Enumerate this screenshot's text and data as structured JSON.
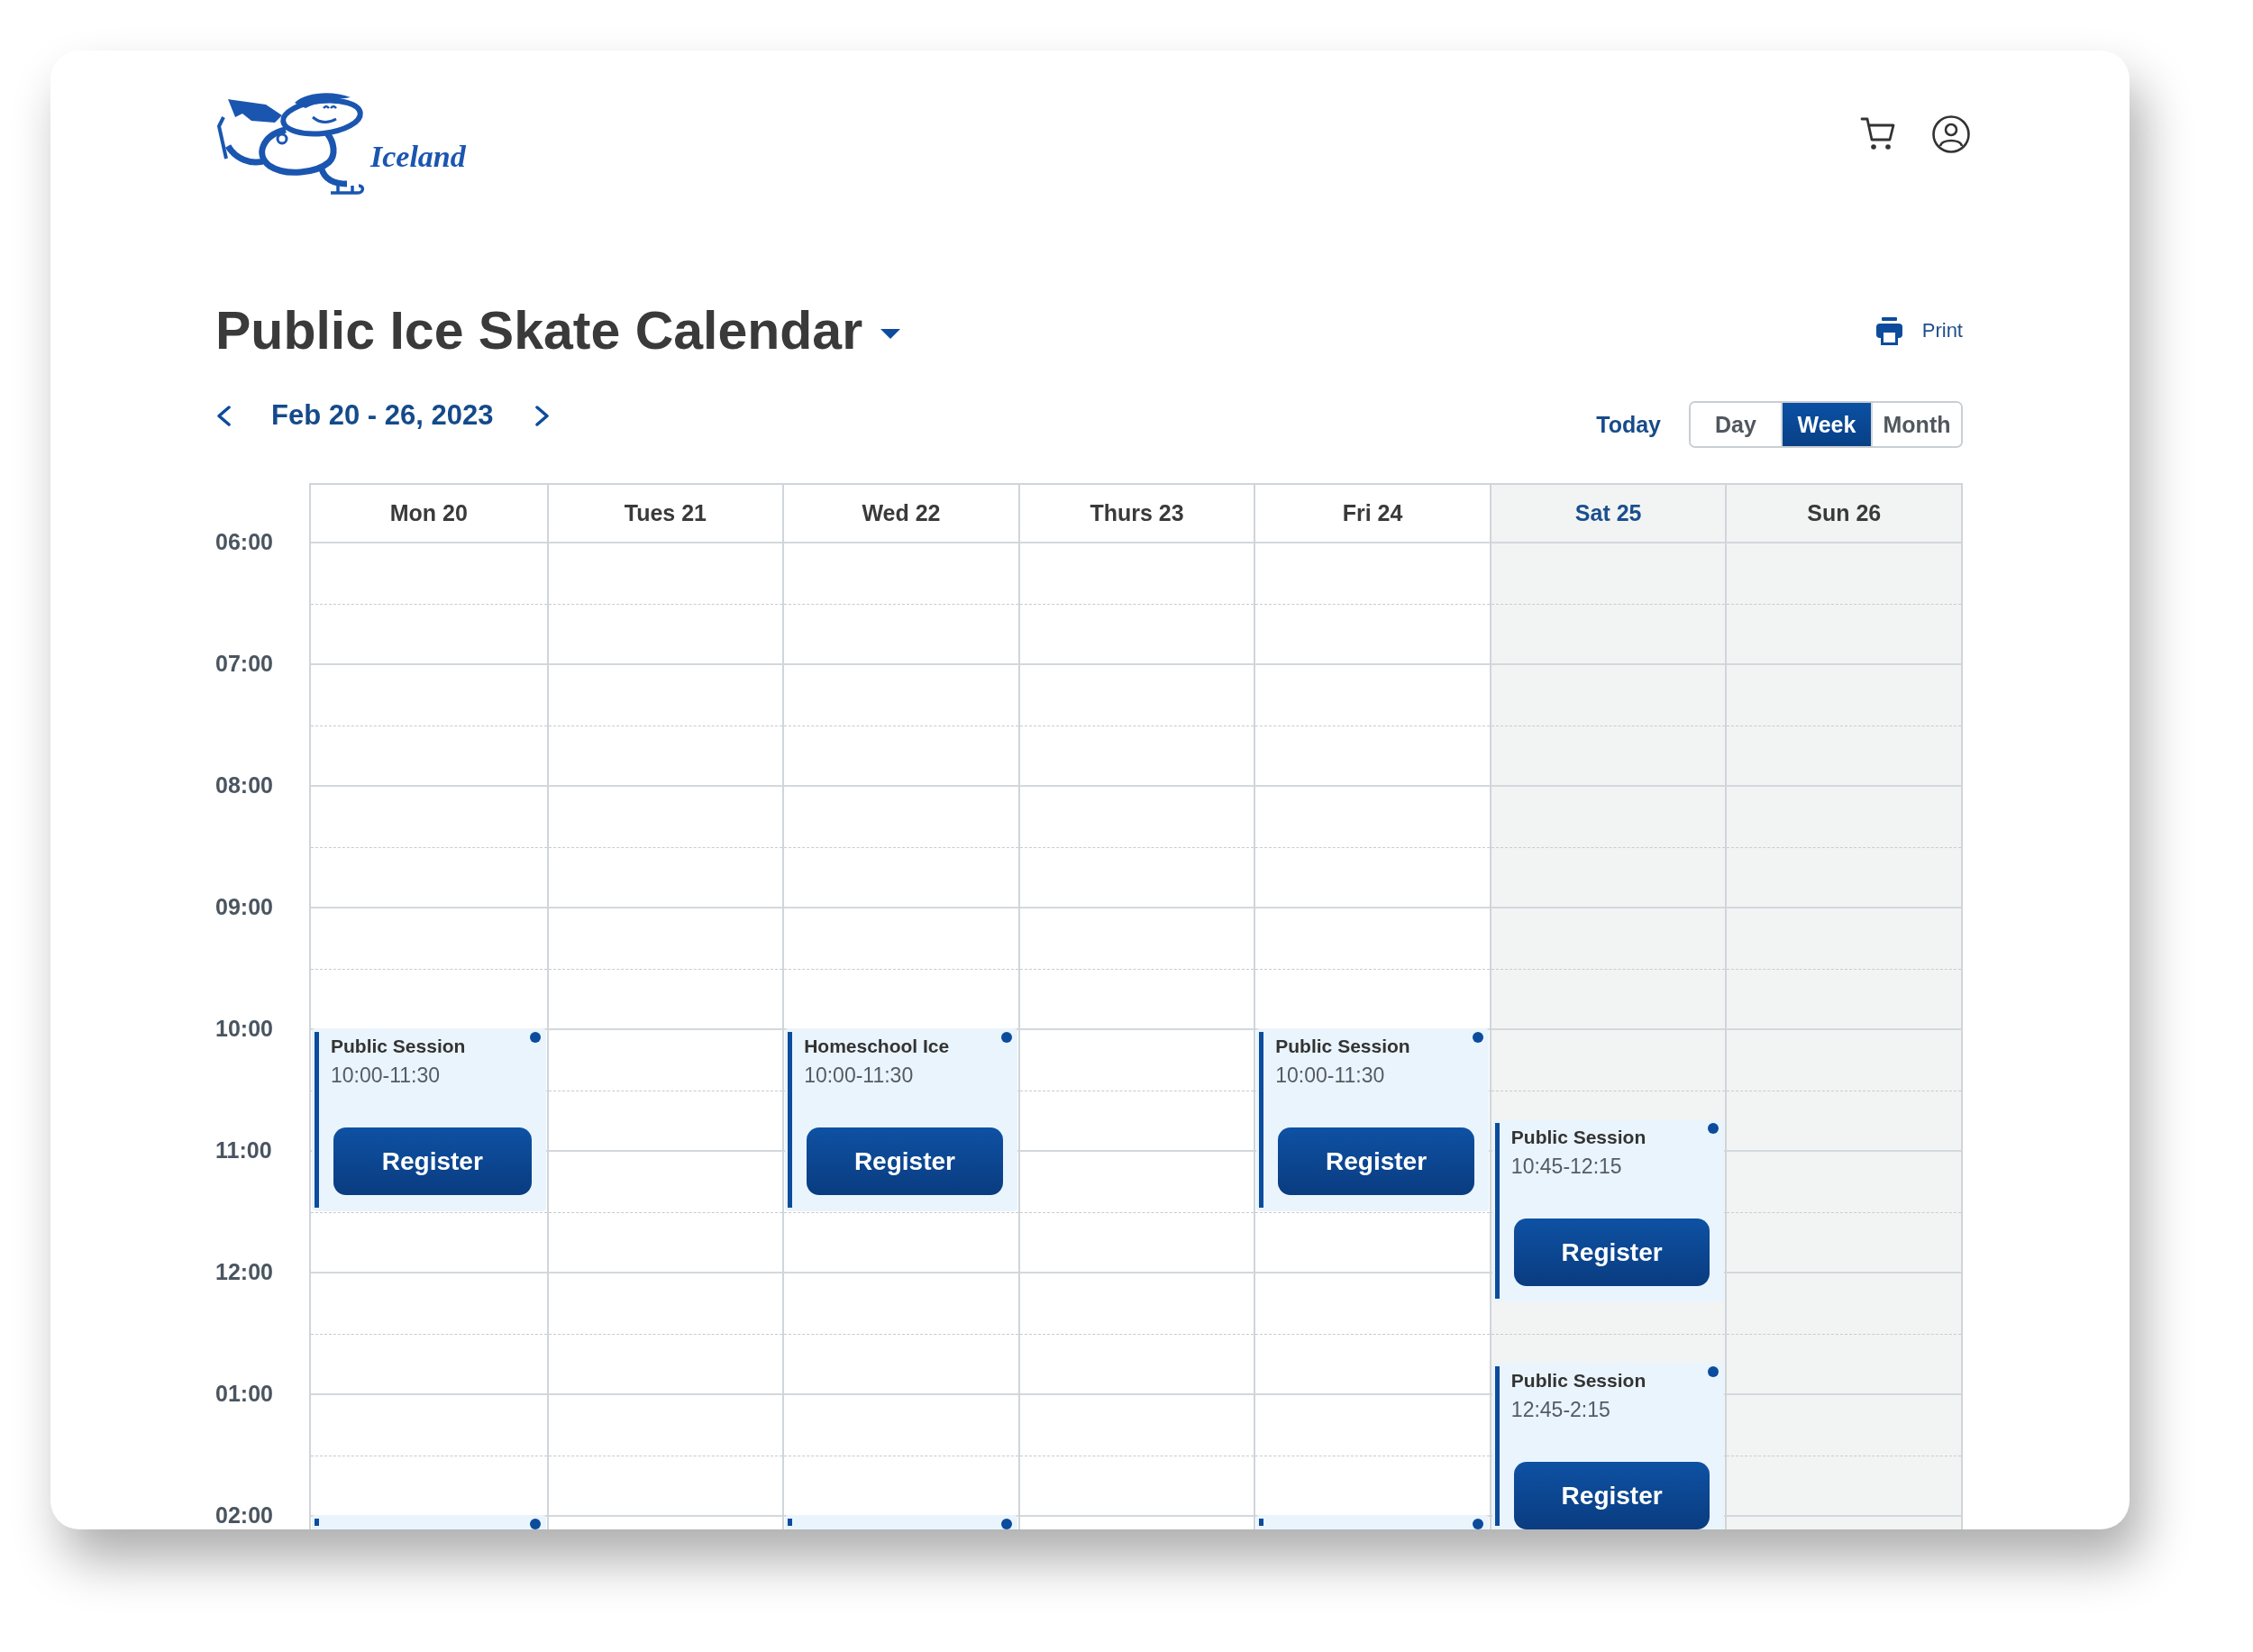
{
  "logo": {
    "text": "Iceland"
  },
  "title": "Public Ice Skate Calendar",
  "print_label": "Print",
  "date_range": "Feb 20 - 26, 2023",
  "today_label": "Today",
  "views": [
    {
      "label": "Day",
      "selected": false
    },
    {
      "label": "Week",
      "selected": true
    },
    {
      "label": "Month",
      "selected": false
    }
  ],
  "time_labels": [
    "06:00",
    "07:00",
    "08:00",
    "09:00",
    "10:00",
    "11:00",
    "12:00",
    "01:00",
    "02:00"
  ],
  "days": [
    {
      "label": "Mon 20",
      "today": false,
      "shaded": false,
      "events": [
        {
          "kind": "session",
          "title": "Public Session",
          "time": "10:00-11:30",
          "button": "Register"
        },
        {
          "kind": "cut_off"
        }
      ]
    },
    {
      "label": "Tues 21",
      "today": false,
      "shaded": false
    },
    {
      "label": "Wed 22",
      "today": false,
      "shaded": false,
      "events": [
        {
          "kind": "session",
          "title": "Homeschool Ice",
          "time": "10:00-11:30",
          "button": "Register"
        },
        {
          "kind": "cut_off"
        }
      ]
    },
    {
      "label": "Thurs 23",
      "today": false,
      "shaded": false
    },
    {
      "label": "Fri 24",
      "today": false,
      "shaded": false,
      "events": [
        {
          "kind": "session",
          "title": "Public Session",
          "time": "10:00-11:30",
          "button": "Register"
        },
        {
          "kind": "cut_off"
        }
      ]
    },
    {
      "label": "Sat 25",
      "today": true,
      "shaded": true,
      "events": [
        {
          "kind": "session",
          "title": "Public Session",
          "time": "10:45-12:15",
          "button": "Register"
        },
        {
          "kind": "session",
          "title": "Public Session",
          "time": "12:45-2:15",
          "button": "Register"
        }
      ]
    },
    {
      "label": "Sun 26",
      "today": false,
      "shaded": true
    }
  ]
}
